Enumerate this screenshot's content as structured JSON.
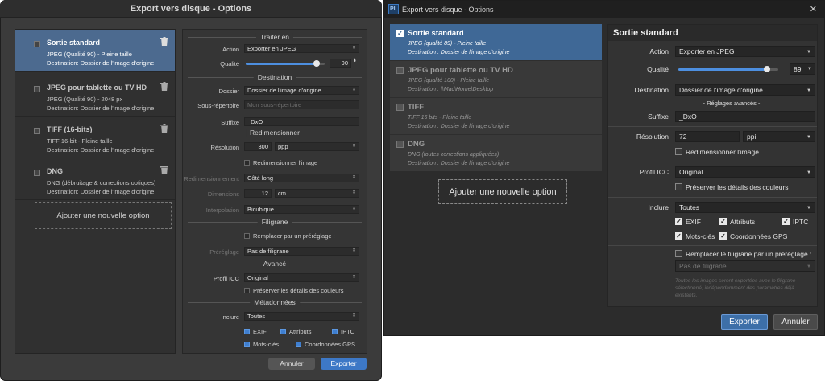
{
  "win1": {
    "title": "Export vers disque - Options",
    "items": [
      {
        "name": "Sortie standard",
        "line2": "JPEG (Qualité 90) - Pleine taille",
        "line3": "Destination: Dossier de l'image d'origine"
      },
      {
        "name": "JPEG pour tablette ou TV HD",
        "line2": "JPEG (Qualité 90) - 2048 px",
        "line3": "Destination: Dossier de l'image d'origine"
      },
      {
        "name": "TIFF (16-bits)",
        "line2": "TIFF 16-bit - Pleine taille",
        "line3": "Destination: Dossier de l'image d'origine"
      },
      {
        "name": "DNG",
        "line2": "DNG (débruitage & corrections optiques)",
        "line3": "Destination: Dossier de l'image d'origine"
      }
    ],
    "add_label": "Ajouter une nouvelle option",
    "sections": {
      "traiter": "Traiter en",
      "destination": "Destination",
      "redim": "Redimensionner",
      "filigrane": "Filigrane",
      "avance": "Avancé",
      "meta": "Métadonnées"
    },
    "labels": {
      "action": "Action",
      "qualite": "Qualité",
      "dossier": "Dossier",
      "sousrep": "Sous-répertoire",
      "suffixe": "Suffixe",
      "resolution": "Résolution",
      "redimensionnement": "Redimensionnement",
      "dimensions": "Dimensions",
      "interpolation": "Interpolation",
      "preglage": "Préréglage",
      "profil": "Profil ICC",
      "inclure": "Inclure"
    },
    "values": {
      "action": "Exporter en JPEG",
      "qualite": "90",
      "quality_fraction": 0.9,
      "dossier": "Dossier de l'image d'origine",
      "sousrep_placeholder": "Mon sous-répertoire",
      "suffixe": "_DxO",
      "resolution": "300",
      "resolution_unit": "ppp",
      "redimensionner_label": "Redimensionner l'image",
      "redimensionnement": "Côté long",
      "dimensions": "12",
      "dimensions_unit": "cm",
      "interpolation": "Bicubique",
      "remplacer_label": "Remplacer par un préréglage :",
      "preglage": "Pas de filigrane",
      "profil": "Original",
      "preserver_label": "Préserver les détails des couleurs",
      "inclure": "Toutes"
    },
    "meta_checks": {
      "exif": "EXIF",
      "attributs": "Attributs",
      "iptc": "IPTC",
      "motscles": "Mots-clés",
      "gps": "Coordonnées GPS"
    },
    "buttons": {
      "annuler": "Annuler",
      "exporter": "Exporter"
    }
  },
  "win2": {
    "logo": "PL",
    "title": "Export vers disque - Options",
    "close": "✕",
    "items": [
      {
        "name": "Sortie standard",
        "line2": "JPEG (qualité 89) - Pleine taille",
        "line3": "Destination : Dossier de l'image d'origine"
      },
      {
        "name": "JPEG pour tablette ou TV HD",
        "line2": "JPEG (qualité 100) - Pleine taille",
        "line3": "Destination : \\\\Mac\\Home\\Desktop"
      },
      {
        "name": "TIFF",
        "line2": "TIFF 16 bits - Pleine taille",
        "line3": "Destination : Dossier de l'image d'origine"
      },
      {
        "name": "DNG",
        "line2": "DNG (toutes corrections appliquées)",
        "line3": "Destination : Dossier de l'image d'origine"
      }
    ],
    "add_label": "Ajouter une nouvelle option",
    "panel_title": "Sortie standard",
    "labels": {
      "action": "Action",
      "qualite": "Qualité",
      "destination": "Destination",
      "reglages": "- Réglages avancés -",
      "suffixe": "Suffixe",
      "resolution": "Résolution",
      "profil": "Profil ICC",
      "inclure": "Inclure"
    },
    "values": {
      "action": "Exporter en JPEG",
      "qualite": "89",
      "quality_fraction": 0.89,
      "destination": "Dossier de l'image d'origine",
      "suffixe": "_DxO",
      "resolution": "72",
      "resolution_unit": "ppi",
      "redimensionner_label": "Redimensionner l'image",
      "profil": "Original",
      "preserver_label": "Préserver les détails des couleurs",
      "inclure": "Toutes",
      "remplacer_label": "Remplacer le filigrane par un préréglage :",
      "filigrane": "Pas de filigrane",
      "note": "Toutes les images seront exportées avec le filigrane sélectionné, indépendamment des paramètres déjà existants."
    },
    "meta_checks": {
      "exif": "EXIF",
      "attributs": "Attributs",
      "iptc": "IPTC",
      "motscles": "Mots-clés",
      "gps": "Coordonnées GPS"
    },
    "buttons": {
      "exporter": "Exporter",
      "annuler": "Annuler"
    }
  },
  "colors": {
    "accent": "#3f7fd0",
    "selected_item_1": "#4c6a8f",
    "selected_item_2": "#3f6896",
    "export_button": "#3d78c6"
  }
}
